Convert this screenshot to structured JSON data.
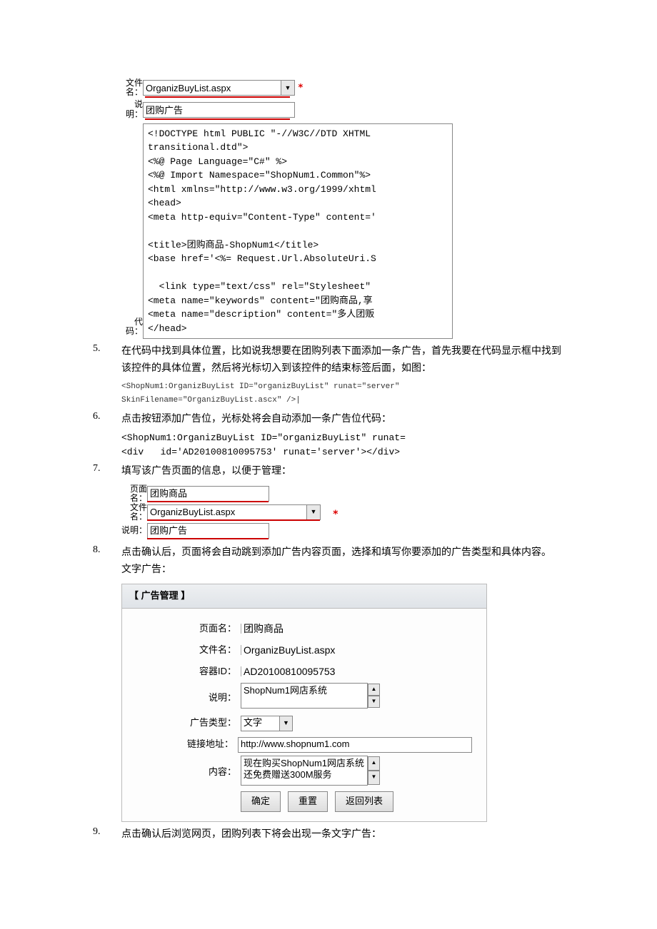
{
  "top_form": {
    "file_label": "文件名：",
    "file_value": "OrganizBuyList.aspx",
    "desc_label": "说明：",
    "desc_value": "团购广告",
    "code_label": "代码：",
    "code_lines": "<!DOCTYPE html PUBLIC \"-//W3C//DTD XHTML\ntransitional.dtd\">\n<%@ Page Language=\"C#\" %>\n<%@ Import Namespace=\"ShopNum1.Common\"%>\n<html xmlns=\"http://www.w3.org/1999/xhtml\n<head>\n<meta http-equiv=\"Content-Type\" content='\n\n<title>团购商品-ShopNum1</title>\n<base href='<%= Request.Url.AbsoluteUri.S\n\n  <link type=\"text/css\" rel=\"Stylesheet\"\n<meta name=\"keywords\" content=\"团购商品,享\n<meta name=\"description\" content=\"多人团贩\n</head>"
  },
  "items": {
    "i5": {
      "num": "5.",
      "text": "在代码中找到具体位置，比如说我想要在团购列表下面添加一条广告，首先我要在代码显示框中找到该控件的具体位置，然后将光标切入到该控件的结束标签后面，如图：",
      "code": "<ShopNum1:OrganizBuyList ID=\"organizBuyList\" runat=\"server\" SkinFilename=\"OrganizBuyList.ascx\"  />|"
    },
    "i6": {
      "num": "6.",
      "text": "点击按钮添加广告位，光标处将会自动添加一条广告位代码：",
      "code": "<ShopNum1:OrganizBuyList ID=\"organizBuyList\" runat=\n<div   id='AD20100810095753' runat='server'></div>"
    },
    "i7": {
      "num": "7.",
      "text": "填写该广告页面的信息，以便于管理：",
      "form": {
        "page_label": "页面名：",
        "page_value": "团购商品",
        "file_label": "文件名：",
        "file_value": "OrganizBuyList.aspx",
        "desc_label": "说明：",
        "desc_value": "团购广告"
      }
    },
    "i8": {
      "num": "8.",
      "text": "点击确认后，页面将会自动跳到添加广告内容页面，选择和填写你要添加的广告类型和具体内容。",
      "text2": "文字广告：",
      "mgmt": {
        "title": "【 广告管理 】",
        "rows": {
          "page_name_label": "页面名：",
          "page_name_value": "团购商品",
          "file_name_label": "文件名：",
          "file_name_value": "OrganizBuyList.aspx",
          "container_id_label": "容器ID：",
          "container_id_value": "AD20100810095753",
          "desc_label": "说明：",
          "desc_value": "ShopNum1网店系统",
          "ad_type_label": "广告类型：",
          "ad_type_value": "文字",
          "link_label": "链接地址：",
          "link_value": "http://www.shopnum1.com",
          "content_label": "内容：",
          "content_value": "现在购买ShopNum1网店系统还免费赠送300M服务",
          "btn_ok": "确定",
          "btn_reset": "重置",
          "btn_back": "返回列表"
        }
      }
    },
    "i9": {
      "num": "9.",
      "text": "点击确认后浏览网页，团购列表下将会出现一条文字广告："
    }
  }
}
